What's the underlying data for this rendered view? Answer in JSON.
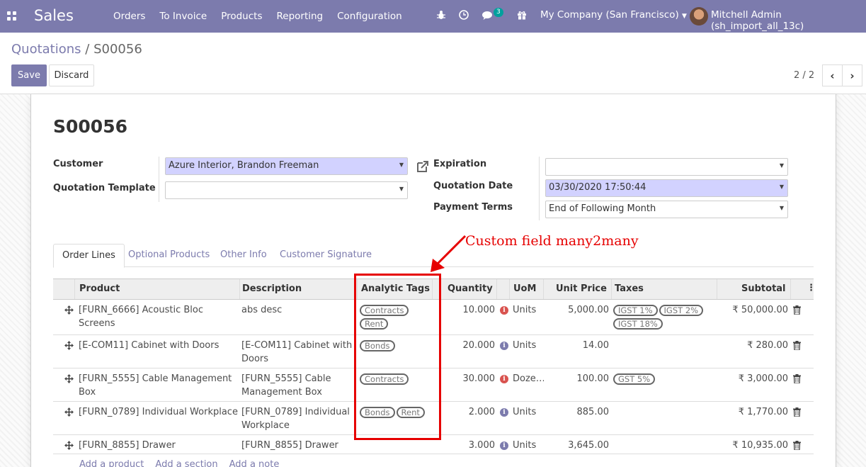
{
  "navbar": {
    "brand": "Sales",
    "menu": [
      "Orders",
      "To Invoice",
      "Products",
      "Reporting",
      "Configuration"
    ],
    "chat_count": "3",
    "company": "My Company (San Francisco)",
    "user": "Mitchell Admin (sh_import_all_13c)"
  },
  "breadcrumb": {
    "parent": "Quotations",
    "separator": "/",
    "current": "S00056"
  },
  "buttons": {
    "save": "Save",
    "discard": "Discard"
  },
  "pager": {
    "value": "2 / 2"
  },
  "record": {
    "name": "S00056",
    "customer_label": "Customer",
    "customer": "Azure Interior, Brandon Freeman",
    "template_label": "Quotation Template",
    "template": "",
    "expiration_label": "Expiration",
    "expiration": "",
    "date_label": "Quotation Date",
    "date": "03/30/2020 17:50:44",
    "terms_label": "Payment Terms",
    "terms": "End of Following Month"
  },
  "tabs": [
    "Order Lines",
    "Optional Products",
    "Other Info",
    "Customer Signature"
  ],
  "table": {
    "headers": {
      "product": "Product",
      "description": "Description",
      "tags": "Analytic Tags",
      "quantity": "Quantity",
      "uom": "UoM",
      "price": "Unit Price",
      "taxes": "Taxes",
      "subtotal": "Subtotal"
    },
    "rows": [
      {
        "product": "[FURN_6666] Acoustic Bloc Screens",
        "description": "abs desc",
        "tags": [
          "Contracts",
          "Rent"
        ],
        "quantity": "10.000",
        "info": "red",
        "uom": "Units",
        "price": "5,000.00",
        "taxes": [
          "IGST 1%",
          "IGST 2%",
          "IGST 18%"
        ],
        "subtotal": "₹ 50,000.00"
      },
      {
        "product": "[E-COM11] Cabinet with Doors",
        "description": "[E-COM11] Cabinet with Doors",
        "tags": [
          "Bonds"
        ],
        "quantity": "20.000",
        "info": "blue",
        "uom": "Units",
        "price": "14.00",
        "taxes": [],
        "subtotal": "₹ 280.00"
      },
      {
        "product": "[FURN_5555] Cable Management Box",
        "description": "[FURN_5555] Cable Management Box",
        "tags": [
          "Contracts"
        ],
        "quantity": "30.000",
        "info": "red",
        "uom": "Doze…",
        "price": "100.00",
        "taxes": [
          "GST 5%"
        ],
        "subtotal": "₹ 3,000.00"
      },
      {
        "product": "[FURN_0789] Individual Workplace",
        "description": "[FURN_0789] Individual Workplace",
        "tags": [
          "Bonds",
          "Rent"
        ],
        "quantity": "2.000",
        "info": "blue",
        "uom": "Units",
        "price": "885.00",
        "taxes": [],
        "subtotal": "₹ 1,770.00"
      },
      {
        "product": "[FURN_8855] Drawer",
        "description": "[FURN_8855] Drawer",
        "tags": [],
        "quantity": "3.000",
        "info": "blue",
        "uom": "Units",
        "price": "3,645.00",
        "taxes": [],
        "subtotal": "₹ 10,935.00"
      }
    ]
  },
  "add_links": [
    "Add a product",
    "Add a section",
    "Add a note"
  ],
  "annotation": {
    "text": "Custom field many2many"
  },
  "colors": {
    "navbar": "#7c7bad",
    "required": "#d2d2ff",
    "annotation": "#e60000",
    "info_red": "#d9534f",
    "info_blue": "#7c7bad"
  }
}
